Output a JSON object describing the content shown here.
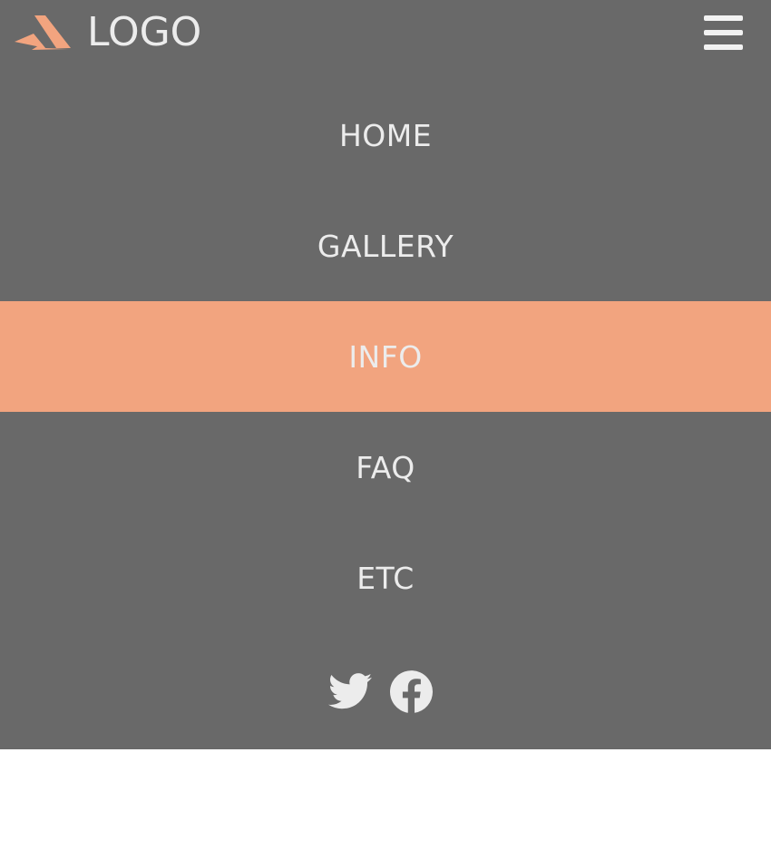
{
  "header": {
    "logo_text": "LOGO",
    "logo_icon": "paper-plane-logo-icon",
    "menu_icon": "hamburger-menu-icon"
  },
  "nav": {
    "items": [
      {
        "label": "HOME",
        "active": false
      },
      {
        "label": "GALLERY",
        "active": false
      },
      {
        "label": "INFO",
        "active": true
      },
      {
        "label": "FAQ",
        "active": false
      },
      {
        "label": "ETC",
        "active": false
      }
    ]
  },
  "social": {
    "icons": [
      "twitter-icon",
      "facebook-icon"
    ]
  },
  "colors": {
    "menu_background": "#696969",
    "accent": "#f2a47f",
    "text": "#ececec",
    "page_background": "#ffffff"
  }
}
